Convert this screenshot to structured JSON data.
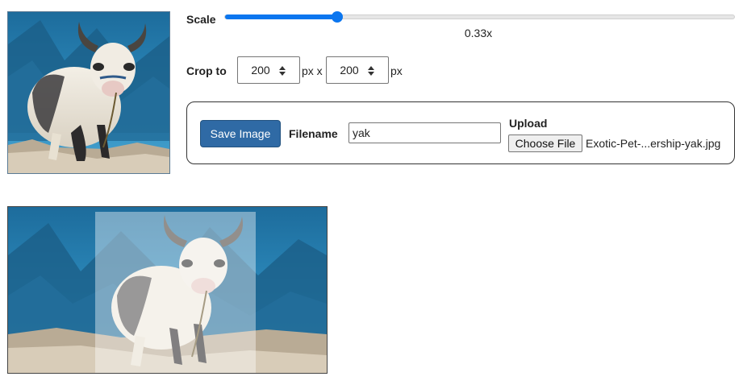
{
  "scale": {
    "label": "Scale",
    "value_text": "0.33x",
    "fraction": 0.22
  },
  "crop": {
    "label": "Crop to",
    "width": "200",
    "height": "200",
    "unit_x": "px x",
    "unit_end": "px"
  },
  "actions": {
    "save_label": "Save Image",
    "filename_label": "Filename",
    "filename_value": "yak",
    "upload_label": "Upload",
    "choose_file_label": "Choose File",
    "selected_file": "Exotic-Pet-...ership-yak.jpg"
  },
  "colors": {
    "accent": "#0b76ef",
    "save_button": "#2f6aa5",
    "sky": "#2a7fb0"
  },
  "icons": {
    "spinner": "spinner-arrows-icon"
  }
}
